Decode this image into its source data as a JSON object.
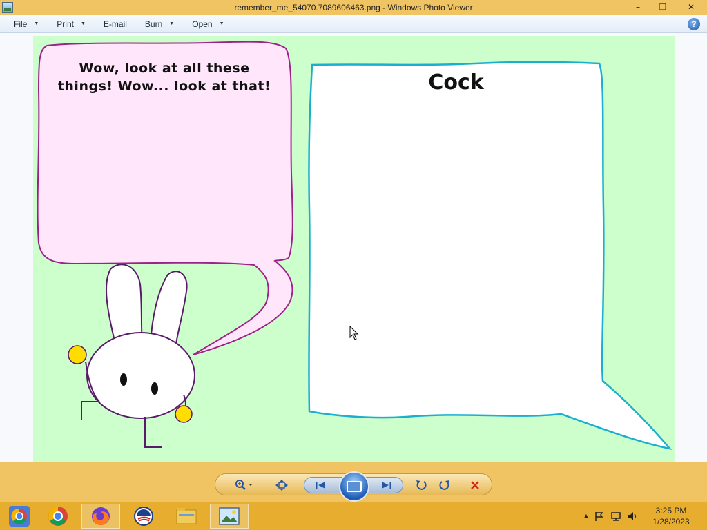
{
  "window": {
    "title": "remember_me_54070.7089606463.png - Windows Photo Viewer",
    "minimize_glyph": "–",
    "restore_glyph": "❐",
    "close_glyph": "✕"
  },
  "menu": {
    "items": [
      {
        "label": "File",
        "has_arrow": true
      },
      {
        "label": "Print",
        "has_arrow": true
      },
      {
        "label": "E-mail",
        "has_arrow": false
      },
      {
        "label": "Burn",
        "has_arrow": true
      },
      {
        "label": "Open",
        "has_arrow": true
      }
    ],
    "arrow_glyph": "▼",
    "help_glyph": "?"
  },
  "image": {
    "left_bubble_text_line1": "Wow, look at all these",
    "left_bubble_text_line2": "things! Wow... look at that!",
    "right_bubble_text": "Cock",
    "colors": {
      "background": "#ccffcc",
      "left_bubble_fill": "#ffe6fb",
      "left_bubble_stroke": "#a0208a",
      "right_bubble_fill": "#ffffff",
      "right_bubble_stroke": "#1aaed0",
      "bunny_outline": "#5a1a6a",
      "bunny_hands": "#ffdd00"
    }
  },
  "controls": {
    "zoom_icon": "zoom-icon",
    "fit_icon": "fit-window-icon",
    "previous_icon": "previous-icon",
    "slideshow_icon": "slideshow-icon",
    "next_icon": "next-icon",
    "rotate_ccw_icon": "rotate-counterclockwise-icon",
    "rotate_cw_icon": "rotate-clockwise-icon",
    "delete_icon": "delete-icon"
  },
  "taskbar": {
    "apps": [
      "chrome-remote-icon",
      "chrome-icon",
      "firefox-icon",
      "obama-logo-icon",
      "file-explorer-icon",
      "photo-viewer-icon"
    ],
    "tray_up_glyph": "▲",
    "time": "3:25 PM",
    "date": "1/28/2023"
  }
}
